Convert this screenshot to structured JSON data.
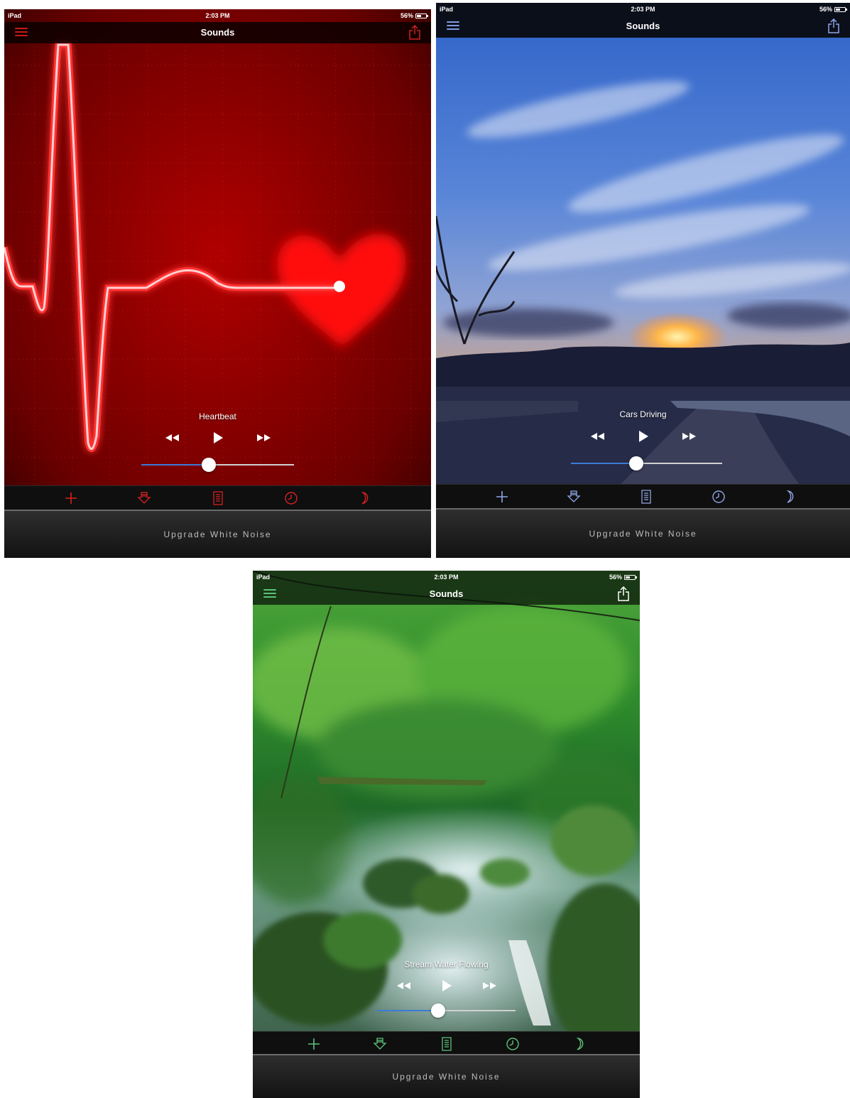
{
  "status": {
    "carrier": "iPad",
    "time": "2:03 PM",
    "battery": "56%",
    "battery_level": 0.56
  },
  "nav_title": "Sounds",
  "upgrade_label": "Upgrade White Noise",
  "transport": {
    "rewind": "◀◀",
    "play": "▶",
    "forward": "▶▶"
  },
  "screens": [
    {
      "theme": "heartbeat",
      "track": "Heartbeat",
      "accent": "#e01010",
      "volume": 0.44
    },
    {
      "theme": "sunset-road",
      "track": "Cars Driving",
      "accent": "#8ea6e8",
      "volume": 0.43
    },
    {
      "theme": "forest-stream",
      "track": "Stream Water Flowing",
      "accent": "#5cc27a",
      "volume": 0.44
    }
  ],
  "toolbar_icons": [
    "plus-icon",
    "download-icon",
    "list-icon",
    "clock-icon",
    "moon-icon"
  ]
}
